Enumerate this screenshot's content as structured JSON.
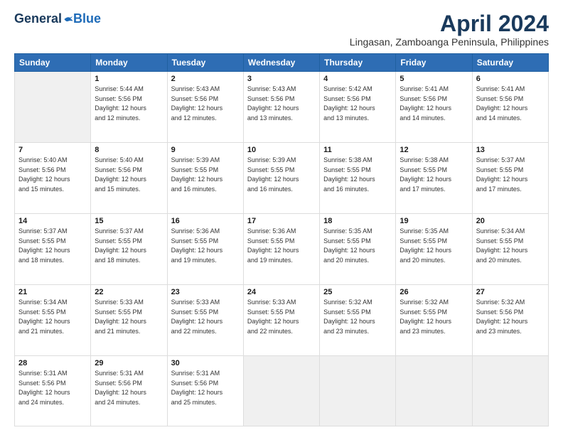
{
  "logo": {
    "general": "General",
    "blue": "Blue"
  },
  "header": {
    "title": "April 2024",
    "location": "Lingasan, Zamboanga Peninsula, Philippines"
  },
  "columns": [
    "Sunday",
    "Monday",
    "Tuesday",
    "Wednesday",
    "Thursday",
    "Friday",
    "Saturday"
  ],
  "weeks": [
    [
      {
        "day": "",
        "info": ""
      },
      {
        "day": "1",
        "info": "Sunrise: 5:44 AM\nSunset: 5:56 PM\nDaylight: 12 hours\nand 12 minutes."
      },
      {
        "day": "2",
        "info": "Sunrise: 5:43 AM\nSunset: 5:56 PM\nDaylight: 12 hours\nand 12 minutes."
      },
      {
        "day": "3",
        "info": "Sunrise: 5:43 AM\nSunset: 5:56 PM\nDaylight: 12 hours\nand 13 minutes."
      },
      {
        "day": "4",
        "info": "Sunrise: 5:42 AM\nSunset: 5:56 PM\nDaylight: 12 hours\nand 13 minutes."
      },
      {
        "day": "5",
        "info": "Sunrise: 5:41 AM\nSunset: 5:56 PM\nDaylight: 12 hours\nand 14 minutes."
      },
      {
        "day": "6",
        "info": "Sunrise: 5:41 AM\nSunset: 5:56 PM\nDaylight: 12 hours\nand 14 minutes."
      }
    ],
    [
      {
        "day": "7",
        "info": "Sunrise: 5:40 AM\nSunset: 5:56 PM\nDaylight: 12 hours\nand 15 minutes."
      },
      {
        "day": "8",
        "info": "Sunrise: 5:40 AM\nSunset: 5:56 PM\nDaylight: 12 hours\nand 15 minutes."
      },
      {
        "day": "9",
        "info": "Sunrise: 5:39 AM\nSunset: 5:55 PM\nDaylight: 12 hours\nand 16 minutes."
      },
      {
        "day": "10",
        "info": "Sunrise: 5:39 AM\nSunset: 5:55 PM\nDaylight: 12 hours\nand 16 minutes."
      },
      {
        "day": "11",
        "info": "Sunrise: 5:38 AM\nSunset: 5:55 PM\nDaylight: 12 hours\nand 16 minutes."
      },
      {
        "day": "12",
        "info": "Sunrise: 5:38 AM\nSunset: 5:55 PM\nDaylight: 12 hours\nand 17 minutes."
      },
      {
        "day": "13",
        "info": "Sunrise: 5:37 AM\nSunset: 5:55 PM\nDaylight: 12 hours\nand 17 minutes."
      }
    ],
    [
      {
        "day": "14",
        "info": "Sunrise: 5:37 AM\nSunset: 5:55 PM\nDaylight: 12 hours\nand 18 minutes."
      },
      {
        "day": "15",
        "info": "Sunrise: 5:37 AM\nSunset: 5:55 PM\nDaylight: 12 hours\nand 18 minutes."
      },
      {
        "day": "16",
        "info": "Sunrise: 5:36 AM\nSunset: 5:55 PM\nDaylight: 12 hours\nand 19 minutes."
      },
      {
        "day": "17",
        "info": "Sunrise: 5:36 AM\nSunset: 5:55 PM\nDaylight: 12 hours\nand 19 minutes."
      },
      {
        "day": "18",
        "info": "Sunrise: 5:35 AM\nSunset: 5:55 PM\nDaylight: 12 hours\nand 20 minutes."
      },
      {
        "day": "19",
        "info": "Sunrise: 5:35 AM\nSunset: 5:55 PM\nDaylight: 12 hours\nand 20 minutes."
      },
      {
        "day": "20",
        "info": "Sunrise: 5:34 AM\nSunset: 5:55 PM\nDaylight: 12 hours\nand 20 minutes."
      }
    ],
    [
      {
        "day": "21",
        "info": "Sunrise: 5:34 AM\nSunset: 5:55 PM\nDaylight: 12 hours\nand 21 minutes."
      },
      {
        "day": "22",
        "info": "Sunrise: 5:33 AM\nSunset: 5:55 PM\nDaylight: 12 hours\nand 21 minutes."
      },
      {
        "day": "23",
        "info": "Sunrise: 5:33 AM\nSunset: 5:55 PM\nDaylight: 12 hours\nand 22 minutes."
      },
      {
        "day": "24",
        "info": "Sunrise: 5:33 AM\nSunset: 5:55 PM\nDaylight: 12 hours\nand 22 minutes."
      },
      {
        "day": "25",
        "info": "Sunrise: 5:32 AM\nSunset: 5:55 PM\nDaylight: 12 hours\nand 23 minutes."
      },
      {
        "day": "26",
        "info": "Sunrise: 5:32 AM\nSunset: 5:55 PM\nDaylight: 12 hours\nand 23 minutes."
      },
      {
        "day": "27",
        "info": "Sunrise: 5:32 AM\nSunset: 5:56 PM\nDaylight: 12 hours\nand 23 minutes."
      }
    ],
    [
      {
        "day": "28",
        "info": "Sunrise: 5:31 AM\nSunset: 5:56 PM\nDaylight: 12 hours\nand 24 minutes."
      },
      {
        "day": "29",
        "info": "Sunrise: 5:31 AM\nSunset: 5:56 PM\nDaylight: 12 hours\nand 24 minutes."
      },
      {
        "day": "30",
        "info": "Sunrise: 5:31 AM\nSunset: 5:56 PM\nDaylight: 12 hours\nand 25 minutes."
      },
      {
        "day": "",
        "info": ""
      },
      {
        "day": "",
        "info": ""
      },
      {
        "day": "",
        "info": ""
      },
      {
        "day": "",
        "info": ""
      }
    ]
  ]
}
